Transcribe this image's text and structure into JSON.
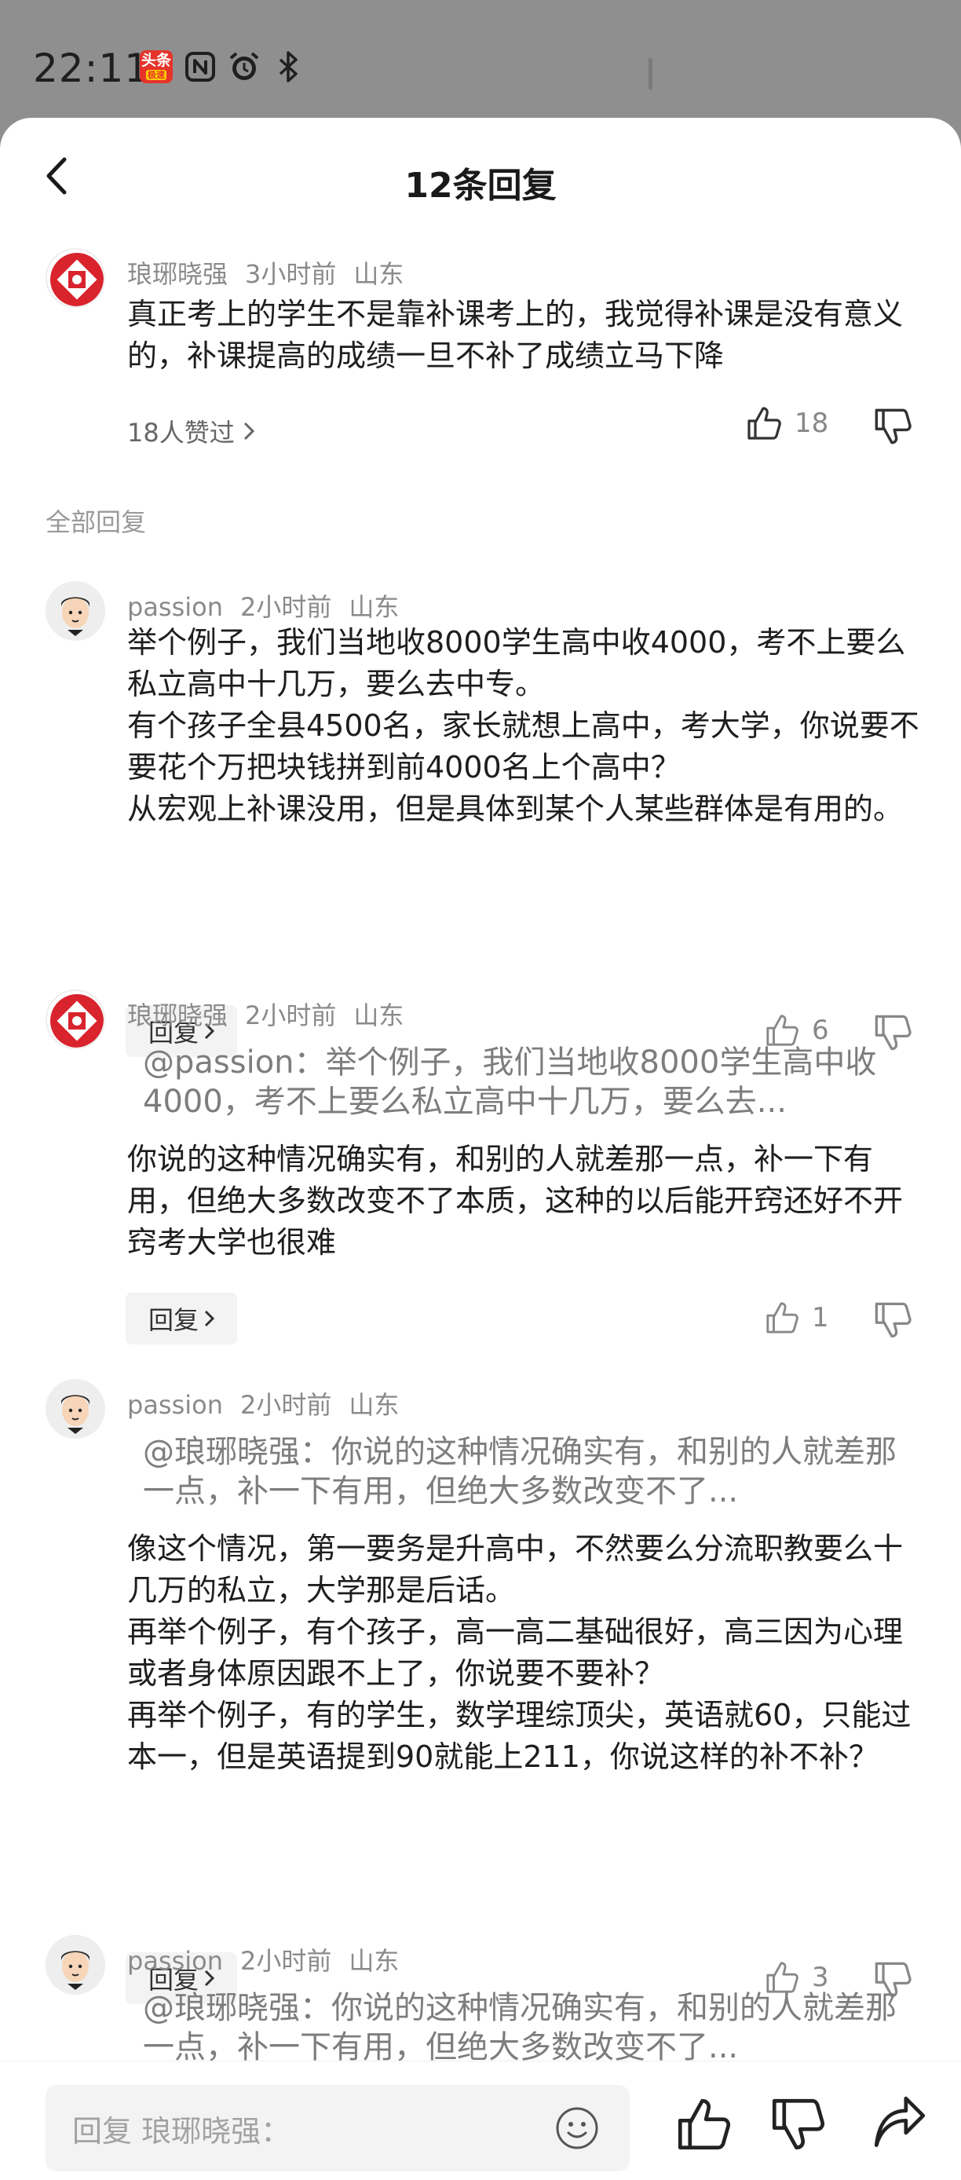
{
  "status": {
    "time": "22:11",
    "app_badge_line1": "头条",
    "app_badge_line2": "极速"
  },
  "header": {
    "title": "12条回复"
  },
  "main_comment": {
    "author": "琅琊晓强",
    "time": "3小时前",
    "location": "山东",
    "text": "真正考上的学生不是靠补课考上的，我觉得补课是没有意义的，补课提高的成绩一旦不补了成绩立马下降",
    "likes_link": "18人赞过",
    "like_count": "18"
  },
  "section_label": "全部回复",
  "reply_label": "回复",
  "replies": [
    {
      "author": "passion",
      "time": "2小时前",
      "location": "山东",
      "text": [
        "举个例子，我们当地收8000学生高中收4000，考不上要么私立高中十几万，要么去中专。",
        "有个孩子全县4500名，家长就想上高中，考大学，你说要不要花个万把块钱拼到前4000名上个高中？",
        "从宏观上补课没用，但是具体到某个人某些群体是有用的。"
      ],
      "like_count": "6"
    },
    {
      "author": "琅琊晓强",
      "time": "2小时前",
      "location": "山东",
      "quote": "@passion：举个例子，我们当地收8000学生高中收4000，考不上要么私立高中十几万，要么去...",
      "text": [
        "你说的这种情况确实有，和别的人就差那一点，补一下有用，但绝大多数改变不了本质，这种的以后能开窍还好不开窍考大学也很难"
      ],
      "like_count": "1"
    },
    {
      "author": "passion",
      "time": "2小时前",
      "location": "山东",
      "quote": "@琅琊晓强：你说的这种情况确实有，和别的人就差那一点，补一下有用，但绝大多数改变不了...",
      "text": [
        "像这个情况，第一要务是升高中，不然要么分流职教要么十几万的私立，大学那是后话。",
        "再举个例子，有个孩子，高一高二基础很好，高三因为心理或者身体原因跟不上了，你说要不要补？",
        "再举个例子，有的学生，数学理综顶尖，英语就60，只能过本一，但是英语提到90就能上211，你说这样的补不补？"
      ],
      "like_count": "3"
    },
    {
      "author": "passion",
      "time": "2小时前",
      "location": "山东",
      "quote": "@琅琊晓强：你说的这种情况确实有，和别的人就差那一点，补一下有用，但绝大多数改变不了..."
    }
  ],
  "bottom_bar": {
    "placeholder": "回复 琅琊晓强："
  },
  "icons": {
    "back": "chevron-left-icon",
    "chevron": "chevron-right-icon",
    "like": "thumbs-up-icon",
    "dislike": "thumbs-down-icon",
    "emoji": "smiley-icon",
    "share": "share-arrow-icon",
    "nfc": "nfc-icon",
    "alarm": "alarm-icon",
    "bluetooth": "bluetooth-icon"
  },
  "colors": {
    "status_bg": "#8f8f8f",
    "sheet_bg": "#ffffff",
    "badge_red": "#e5332a",
    "muted_text": "#8a8a8a",
    "button_bg": "#f3f3f3"
  }
}
